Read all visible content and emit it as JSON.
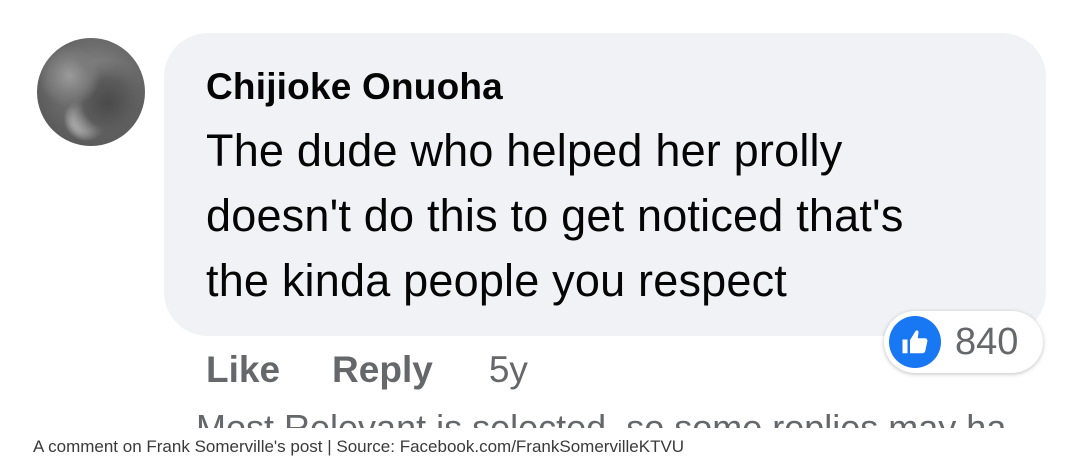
{
  "comment": {
    "author": "Chijioke Onuoha",
    "body_lines": [
      "The dude who helped her prolly",
      "doesn't do this to get noticed that's",
      "the kinda people you respect"
    ],
    "reactions": {
      "icon": "thumbs-up-icon",
      "count": "840",
      "color": "#1877f2"
    },
    "actions": {
      "like_label": "Like",
      "reply_label": "Reply",
      "timestamp": "5y"
    }
  },
  "cutoff_notice": "Most Relevant is selected, so some replies may ha",
  "caption": "A comment on Frank Somerville's post | Source: Facebook.com/FrankSomervilleKTVU",
  "colors": {
    "bubble_bg": "#f0f2f5",
    "secondary_text": "#65676b",
    "primary_text": "#050505"
  }
}
